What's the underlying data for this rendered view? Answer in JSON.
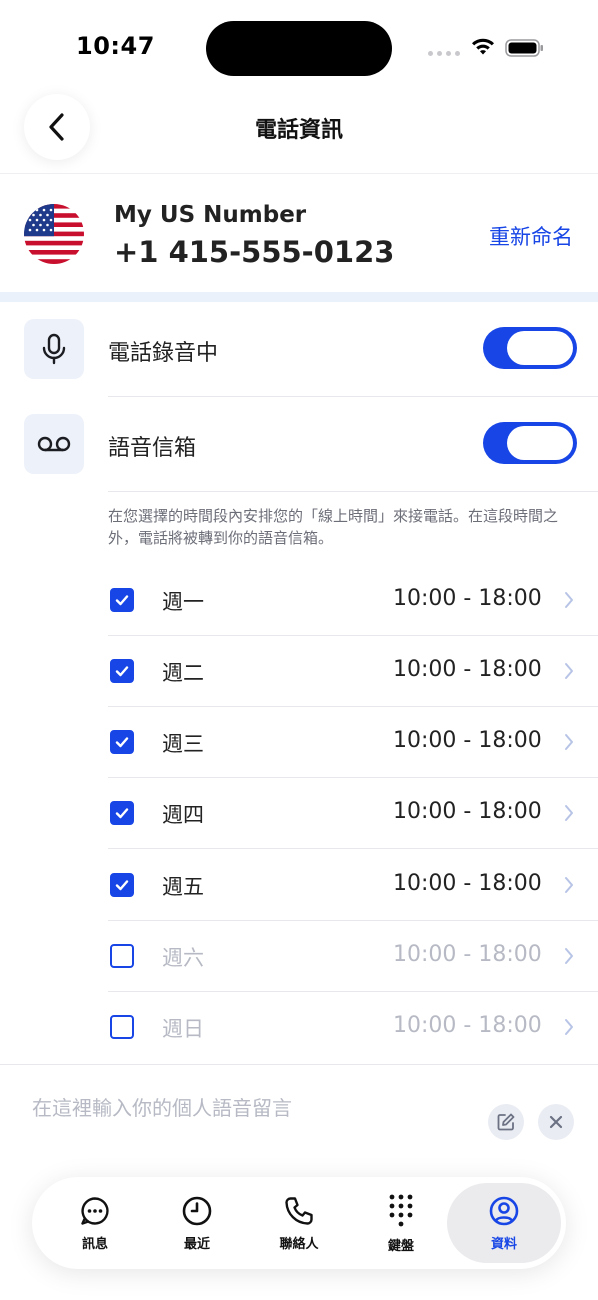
{
  "status_bar": {
    "time": "10:47"
  },
  "header": {
    "title": "電話資訊"
  },
  "number": {
    "name": "My US Number",
    "phone": "+1 415-555-0123",
    "rename_label": "重新命名"
  },
  "settings": {
    "recording": {
      "label": "電話錄音中",
      "enabled": true
    },
    "voicemail": {
      "label": "語音信箱",
      "enabled": true
    }
  },
  "schedule": {
    "description": "在您選擇的時間段內安排您的「線上時間」來接電話。在這段時間之外，電話將被轉到你的語音信箱。",
    "days": [
      {
        "name": "週一",
        "time": "10:00 - 18:00",
        "checked": true
      },
      {
        "name": "週二",
        "time": "10:00 - 18:00",
        "checked": true
      },
      {
        "name": "週三",
        "time": "10:00 - 18:00",
        "checked": true
      },
      {
        "name": "週四",
        "time": "10:00 - 18:00",
        "checked": true
      },
      {
        "name": "週五",
        "time": "10:00 - 18:00",
        "checked": true
      },
      {
        "name": "週六",
        "time": "10:00 - 18:00",
        "checked": false
      },
      {
        "name": "週日",
        "time": "10:00 - 18:00",
        "checked": false
      }
    ]
  },
  "greeting": {
    "placeholder": "在這裡輸入你的個人語音留言"
  },
  "tabs": [
    {
      "label": "訊息",
      "icon": "message-bubble-icon"
    },
    {
      "label": "最近",
      "icon": "clock-icon"
    },
    {
      "label": "聯絡人",
      "icon": "phone-icon"
    },
    {
      "label": "鍵盤",
      "icon": "keypad-icon"
    },
    {
      "label": "資料",
      "icon": "profile-icon",
      "active": true
    }
  ],
  "colors": {
    "accent": "#1846e6",
    "muted": "#b7bac4",
    "band": "#eaf1fb"
  }
}
